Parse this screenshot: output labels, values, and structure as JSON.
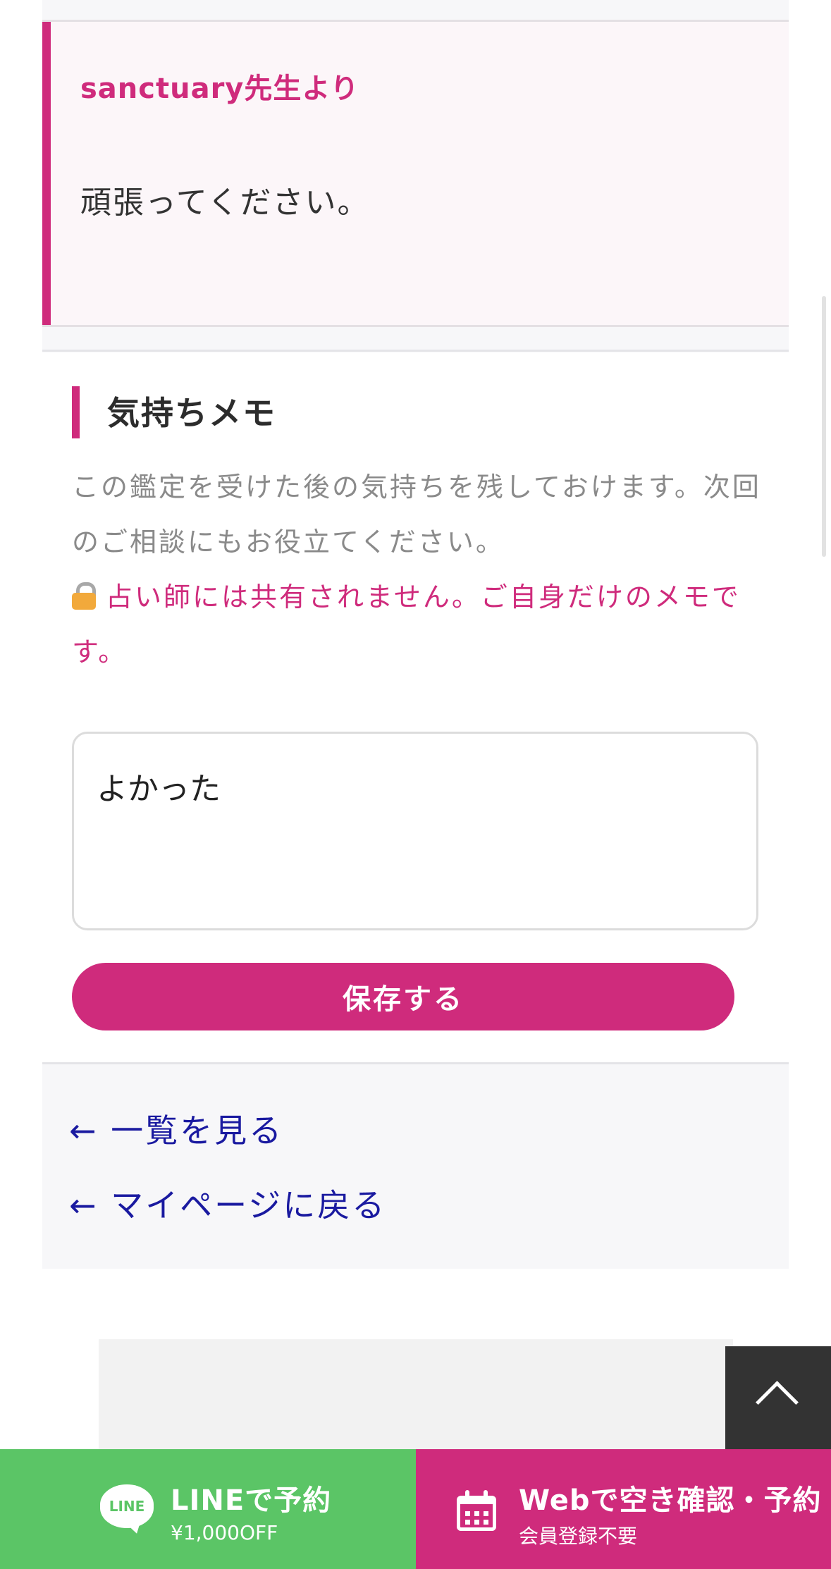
{
  "teacher_comment": {
    "from": "sanctuary先生より",
    "message": "頑張ってください。"
  },
  "memo": {
    "heading": "気持ちメモ",
    "description": "この鑑定を受けた後の気持ちを残しておけます。次回のご相談にもお役立てください。",
    "private_note": "占い師には共有されません。ご自身だけのメモです。",
    "input_value": "よかった",
    "save_label": "保存する"
  },
  "links": {
    "list": "← 一覧を見る",
    "mypage": "← マイページに戻る"
  },
  "bottom_bar": {
    "line": {
      "logo_text": "LINE",
      "label": "LINEで予約",
      "sub": "¥1,000OFF",
      "color": "#5bc566"
    },
    "web": {
      "label": "Webで空き確認・予約",
      "sub": "会員登録不要",
      "color": "#cf2b7c"
    }
  },
  "colors": {
    "accent": "#cf2b7c",
    "link": "#1a1aa0",
    "line_green": "#5bc566"
  }
}
